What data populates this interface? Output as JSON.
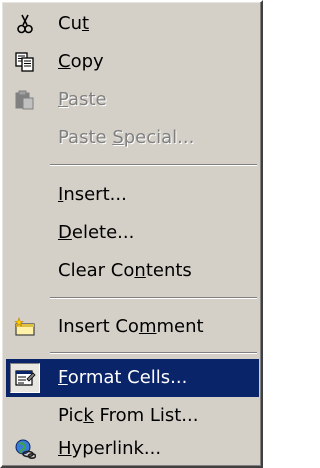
{
  "context_menu": {
    "items": [
      {
        "id": "cut",
        "pre": "Cu",
        "key": "t",
        "post": "",
        "icon": "scissors-icon",
        "enabled": true
      },
      {
        "id": "copy",
        "pre": "",
        "key": "C",
        "post": "opy",
        "icon": "copy-icon",
        "enabled": true
      },
      {
        "id": "paste",
        "pre": "",
        "key": "P",
        "post": "aste",
        "icon": "paste-icon",
        "enabled": false
      },
      {
        "id": "paste-special",
        "pre": "Paste ",
        "key": "S",
        "post": "pecial...",
        "enabled": false
      },
      {
        "id": "insert",
        "pre": "",
        "key": "I",
        "post": "nsert...",
        "enabled": true
      },
      {
        "id": "delete",
        "pre": "",
        "key": "D",
        "post": "elete...",
        "enabled": true
      },
      {
        "id": "clear-contents",
        "pre": "Clear Co",
        "key": "n",
        "post": "tents",
        "enabled": true
      },
      {
        "id": "insert-comment",
        "pre": "Insert Co",
        "key": "m",
        "post": "ment",
        "icon": "new-comment-icon",
        "enabled": true
      },
      {
        "id": "format-cells",
        "pre": "",
        "key": "F",
        "post": "ormat Cells...",
        "icon": "format-cells-icon",
        "enabled": true,
        "highlighted": true
      },
      {
        "id": "pick-from-list",
        "pre": "Pic",
        "key": "k",
        "post": " From List...",
        "enabled": true
      },
      {
        "id": "hyperlink",
        "pre": "",
        "key": "H",
        "post": "yperlink...",
        "icon": "hyperlink-icon",
        "enabled": true
      }
    ]
  },
  "colors": {
    "menu_bg": "#d4d0c8",
    "highlight_bg": "#0a246a",
    "highlight_text": "#ffffff",
    "disabled_text": "#808080"
  }
}
